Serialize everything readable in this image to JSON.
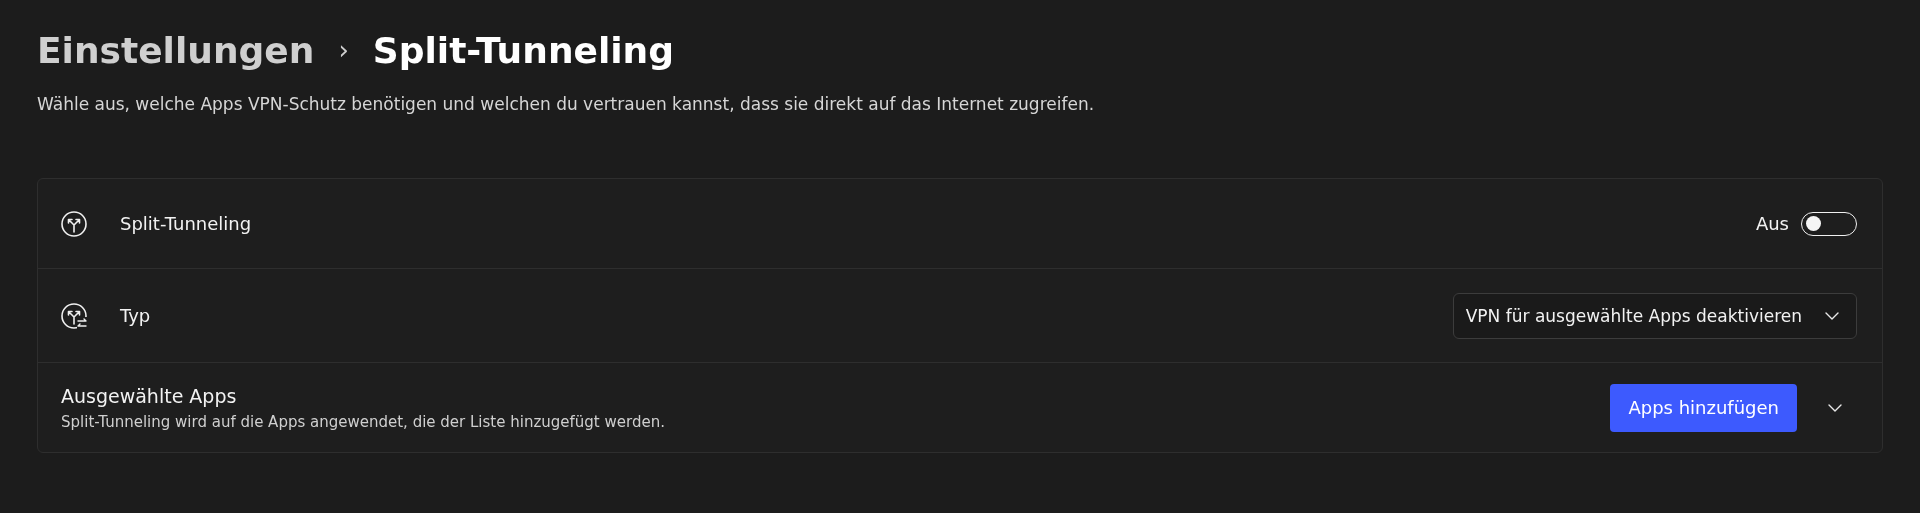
{
  "breadcrumb": {
    "parent": "Einstellungen",
    "separator": "›",
    "current": "Split-Tunneling"
  },
  "description": "Wähle aus, welche Apps VPN-Schutz benötigen und welchen du vertrauen kannst, dass sie direkt auf das Internet zugreifen.",
  "settings": [
    {
      "kind": "toggle",
      "label": "Split-Tunneling",
      "state_label": "Aus",
      "on": false
    },
    {
      "kind": "dropdown",
      "label": "Typ",
      "value": "VPN für ausgewählte Apps deaktivieren"
    },
    {
      "kind": "apps",
      "label": "Ausgewählte Apps",
      "hint": "Split-Tunneling wird auf die Apps angewendet, die der Liste hinzugefügt werden.",
      "button": "Apps hinzufügen",
      "expanded": false
    }
  ]
}
